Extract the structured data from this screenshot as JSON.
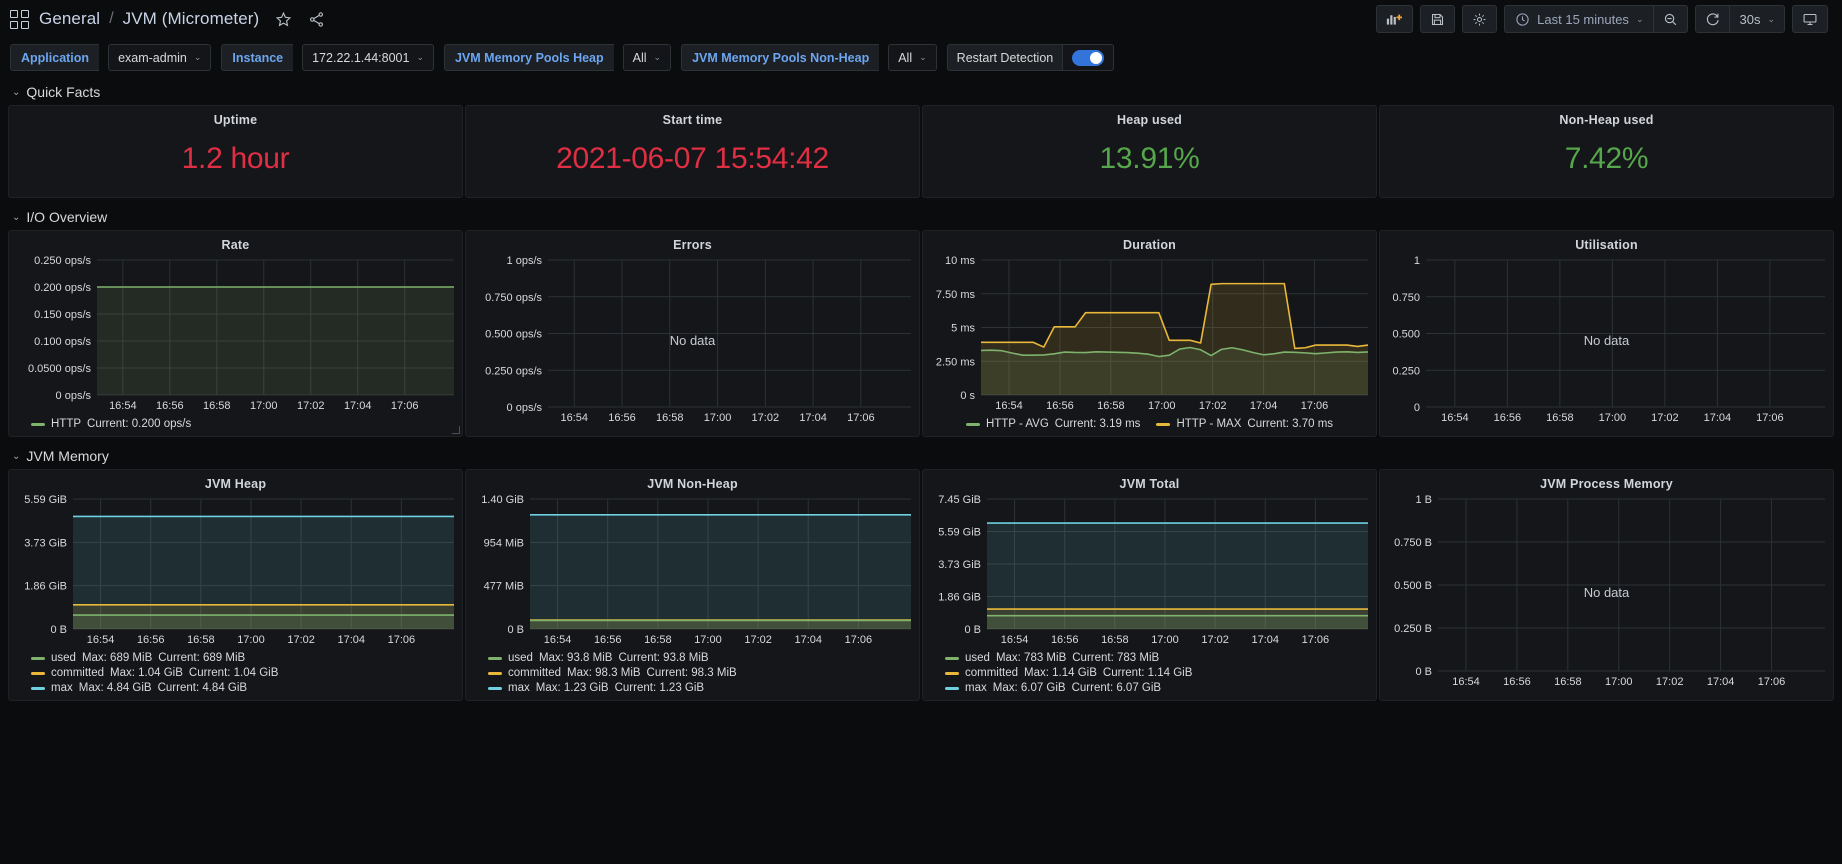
{
  "nav": {
    "grid_icon": "dashboards-grid-icon",
    "breadcrumb_folder": "General",
    "breadcrumb_sep": "/",
    "breadcrumb_title": "JVM (Micrometer)",
    "star_icon": "star-icon",
    "share_icon": "share-icon",
    "add_panel_label": "add-panel-icon",
    "save_label": "save-dashboard-icon",
    "settings_label": "dashboard-settings-icon",
    "time_range": "Last 15 minutes",
    "zoom_out_label": "zoom-out-icon",
    "refresh_label": "refresh-icon",
    "refresh_interval": "30s",
    "tv_label": "cycle-view-mode-icon",
    "caret": "⌄"
  },
  "variables": [
    {
      "label": "Application",
      "value": "exam-admin",
      "type": "select"
    },
    {
      "label": "Instance",
      "value": "172.22.1.44:8001",
      "type": "select"
    },
    {
      "label": "JVM Memory Pools Heap",
      "value": "All",
      "type": "select"
    },
    {
      "label": "JVM Memory Pools Non-Heap",
      "value": "All",
      "type": "select"
    },
    {
      "label": "Restart Detection",
      "value": "on",
      "type": "switch"
    }
  ],
  "sections": [
    {
      "title": "Quick Facts"
    },
    {
      "title": "I/O Overview"
    },
    {
      "title": "JVM Memory"
    }
  ],
  "colors": {
    "red": "#e02f44",
    "green": "#56a64b",
    "series_green": "#7eb26d",
    "series_yellow": "#eab839",
    "series_cyan": "#6ed0e0",
    "accent_blue": "#6ca5f0",
    "toggle_blue": "#3274d9"
  },
  "stats": [
    {
      "title": "Uptime",
      "value": "1.2 hour",
      "color": "red"
    },
    {
      "title": "Start time",
      "value": "2021-06-07 15:54:42",
      "color": "red"
    },
    {
      "title": "Heap used",
      "value": "13.91%",
      "color": "green"
    },
    {
      "title": "Non-Heap used",
      "value": "7.42%",
      "color": "green"
    }
  ],
  "chart_data": [
    {
      "id": "rate",
      "type": "area",
      "title": "Rate",
      "xlabel": "",
      "ylabel": "",
      "grid": true,
      "no_data": false,
      "yticks": [
        "0 ops/s",
        "0.0500 ops/s",
        "0.100 ops/s",
        "0.150 ops/s",
        "0.200 ops/s",
        "0.250 ops/s"
      ],
      "ylim": [
        0,
        0.25
      ],
      "xticks": [
        "16:54",
        "16:56",
        "16:58",
        "17:00",
        "17:02",
        "17:04",
        "17:06"
      ],
      "legend_position": "bottom",
      "series": [
        {
          "name": "HTTP",
          "color": "#7eb26d",
          "stat_label": "Current:",
          "stat_value": "0.200 ops/s",
          "values": [
            0.2,
            0.2,
            0.2,
            0.2,
            0.2,
            0.2,
            0.2,
            0.2,
            0.2,
            0.2,
            0.2,
            0.2,
            0.2,
            0.2,
            0.2,
            0.2,
            0.2,
            0.2,
            0.2,
            0.2,
            0.2,
            0.2,
            0.2,
            0.2,
            0.2,
            0.2,
            0.2,
            0.2,
            0.2,
            0.2
          ]
        }
      ]
    },
    {
      "id": "errors",
      "type": "line",
      "title": "Errors",
      "grid": true,
      "no_data": true,
      "no_data_text": "No data",
      "yticks": [
        "0 ops/s",
        "0.250 ops/s",
        "0.500 ops/s",
        "0.750 ops/s",
        "1 ops/s"
      ],
      "ylim": [
        0,
        1
      ],
      "xticks": [
        "16:54",
        "16:56",
        "16:58",
        "17:00",
        "17:02",
        "17:04",
        "17:06"
      ],
      "series": []
    },
    {
      "id": "duration",
      "type": "area",
      "title": "Duration",
      "grid": true,
      "no_data": false,
      "yticks": [
        "0 s",
        "2.50 ms",
        "5 ms",
        "7.50 ms",
        "10 ms"
      ],
      "ylim": [
        0,
        10
      ],
      "xticks": [
        "16:54",
        "16:56",
        "16:58",
        "17:00",
        "17:02",
        "17:04",
        "17:06"
      ],
      "legend_position": "bottom",
      "series": [
        {
          "name": "HTTP - AVG",
          "color": "#7eb26d",
          "stat_label": "Current:",
          "stat_value": "3.19 ms",
          "values": [
            3.3,
            3.32,
            3.28,
            3.1,
            2.95,
            2.95,
            2.97,
            3.05,
            3.18,
            3.15,
            3.14,
            3.2,
            3.18,
            3.16,
            3.14,
            3.1,
            3.02,
            2.85,
            2.95,
            3.4,
            3.52,
            3.35,
            2.92,
            3.38,
            3.5,
            3.35,
            3.15,
            2.98,
            3.05,
            3.18,
            3.16,
            3.12,
            3.06,
            3.12,
            3.18,
            3.2,
            3.15,
            3.19
          ]
        },
        {
          "name": "HTTP - MAX",
          "color": "#eab839",
          "stat_label": "Current:",
          "stat_value": "3.70 ms",
          "values": [
            3.9,
            3.9,
            3.9,
            3.9,
            3.9,
            3.9,
            3.55,
            5.05,
            5.05,
            5.05,
            6.1,
            6.1,
            6.1,
            6.1,
            6.1,
            6.1,
            6.1,
            6.1,
            4.05,
            4.05,
            4.05,
            3.85,
            8.2,
            8.25,
            8.25,
            8.25,
            8.25,
            8.25,
            8.25,
            8.25,
            3.45,
            3.5,
            3.7,
            3.7,
            3.7,
            3.7,
            3.6,
            3.7
          ]
        }
      ]
    },
    {
      "id": "utilisation",
      "type": "line",
      "title": "Utilisation",
      "grid": true,
      "no_data": true,
      "no_data_text": "No data",
      "yticks": [
        "0",
        "0.250",
        "0.500",
        "0.750",
        "1"
      ],
      "ylim": [
        0,
        1
      ],
      "xticks": [
        "16:54",
        "16:56",
        "16:58",
        "17:00",
        "17:02",
        "17:04",
        "17:06"
      ],
      "series": []
    },
    {
      "id": "jvm-heap",
      "type": "area",
      "title": "JVM Heap",
      "grid": true,
      "no_data": false,
      "yticks": [
        "0 B",
        "1.86 GiB",
        "3.73 GiB",
        "5.59 GiB"
      ],
      "ylim": [
        0,
        5.59
      ],
      "xticks": [
        "16:54",
        "16:56",
        "16:58",
        "17:00",
        "17:02",
        "17:04",
        "17:06"
      ],
      "legend_position": "bottom",
      "series": [
        {
          "name": "used",
          "color": "#7eb26d",
          "stat_label": "Max:",
          "stat_value": "689 MiB",
          "stat_label2": "Current:",
          "stat_value2": "689 MiB",
          "level": 0.6
        },
        {
          "name": "committed",
          "color": "#eab839",
          "stat_label": "Max:",
          "stat_value": "1.04 GiB",
          "stat_label2": "Current:",
          "stat_value2": "1.04 GiB",
          "level": 1.04
        },
        {
          "name": "max",
          "color": "#6ed0e0",
          "stat_label": "Max:",
          "stat_value": "4.84 GiB",
          "stat_label2": "Current:",
          "stat_value2": "4.84 GiB",
          "level": 4.84
        }
      ]
    },
    {
      "id": "jvm-non-heap",
      "type": "area",
      "title": "JVM Non-Heap",
      "grid": true,
      "no_data": false,
      "yticks": [
        "0 B",
        "477 MiB",
        "954 MiB",
        "1.40 GiB"
      ],
      "ylim": [
        0,
        1.4
      ],
      "xticks": [
        "16:54",
        "16:56",
        "16:58",
        "17:00",
        "17:02",
        "17:04",
        "17:06"
      ],
      "legend_position": "bottom",
      "series": [
        {
          "name": "used",
          "color": "#7eb26d",
          "stat_label": "Max:",
          "stat_value": "93.8 MiB",
          "stat_label2": "Current:",
          "stat_value2": "93.8 MiB",
          "level": 0.0916
        },
        {
          "name": "committed",
          "color": "#eab839",
          "stat_label": "Max:",
          "stat_value": "98.3 MiB",
          "stat_label2": "Current:",
          "stat_value2": "98.3 MiB",
          "level": 0.096
        },
        {
          "name": "max",
          "color": "#6ed0e0",
          "stat_label": "Max:",
          "stat_value": "1.23 GiB",
          "stat_label2": "Current:",
          "stat_value2": "1.23 GiB",
          "level": 1.23
        }
      ]
    },
    {
      "id": "jvm-total",
      "type": "area",
      "title": "JVM Total",
      "grid": true,
      "no_data": false,
      "yticks": [
        "0 B",
        "1.86 GiB",
        "3.73 GiB",
        "5.59 GiB",
        "7.45 GiB"
      ],
      "ylim": [
        0,
        7.45
      ],
      "xticks": [
        "16:54",
        "16:56",
        "16:58",
        "17:00",
        "17:02",
        "17:04",
        "17:06"
      ],
      "legend_position": "bottom",
      "series": [
        {
          "name": "used",
          "color": "#7eb26d",
          "stat_label": "Max:",
          "stat_value": "783 MiB",
          "stat_label2": "Current:",
          "stat_value2": "783 MiB",
          "level": 0.765
        },
        {
          "name": "committed",
          "color": "#eab839",
          "stat_label": "Max:",
          "stat_value": "1.14 GiB",
          "stat_label2": "Current:",
          "stat_value2": "1.14 GiB",
          "level": 1.14
        },
        {
          "name": "max",
          "color": "#6ed0e0",
          "stat_label": "Max:",
          "stat_value": "6.07 GiB",
          "stat_label2": "Current:",
          "stat_value2": "6.07 GiB",
          "level": 6.07
        }
      ]
    },
    {
      "id": "jvm-process-memory",
      "type": "line",
      "title": "JVM Process Memory",
      "grid": true,
      "no_data": true,
      "no_data_text": "No data",
      "yticks": [
        "0 B",
        "0.250 B",
        "0.500 B",
        "0.750 B",
        "1 B"
      ],
      "ylim": [
        0,
        1
      ],
      "xticks": [
        "16:54",
        "16:56",
        "16:58",
        "17:00",
        "17:02",
        "17:04",
        "17:06"
      ],
      "series": []
    }
  ]
}
